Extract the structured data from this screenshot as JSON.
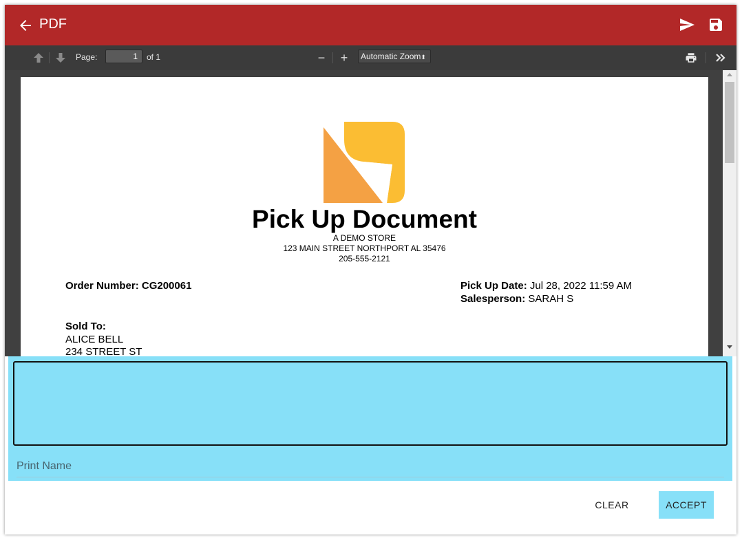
{
  "appbar": {
    "title": "PDF",
    "back_icon": "arrow-left-icon",
    "send_icon": "send-icon",
    "save_icon": "floppy-disk-icon",
    "color": "#b22828"
  },
  "pdf_toolbar": {
    "page_label": "Page:",
    "page_value": "1",
    "page_of": "of 1",
    "zoom_out_label": "−",
    "zoom_in_label": "+",
    "zoom_select": "Automatic Zoom",
    "zoom_arrows": "⬍",
    "icons": [
      "arrow-up-icon",
      "arrow-down-icon",
      "print-icon",
      "double-chevron-right-icon"
    ]
  },
  "document": {
    "logo": "store-logo",
    "title": "Pick Up Document",
    "store_name": "A DEMO STORE",
    "store_address": "123 MAIN STREET NORTHPORT AL 35476",
    "store_phone": "205-555-2121",
    "order_label": "Order Number: ",
    "order_number": "CG200061",
    "pickup_label": "Pick Up Date: ",
    "pickup_date": "Jul 28, 2022 11:59 AM",
    "salesperson_label": "Salesperson: ",
    "salesperson": "SARAH S",
    "sold_to_label": "Sold To:",
    "customer_name": "ALICE BELL",
    "customer_address": "234 STREET ST"
  },
  "signature": {
    "print_name_placeholder": "Print Name",
    "background": "#87e0f8"
  },
  "actions": {
    "clear": "CLEAR",
    "accept": "ACCEPT"
  }
}
